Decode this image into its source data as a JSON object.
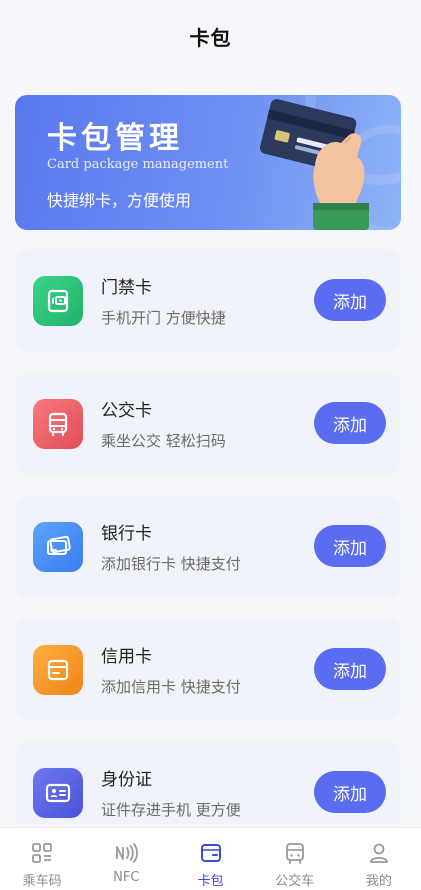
{
  "header": {
    "title": "卡包"
  },
  "banner": {
    "title": "卡包管理",
    "subtitle": "Card package management",
    "description": "快捷绑卡，方便使用"
  },
  "cards": [
    {
      "name": "门禁卡",
      "description": "手机开门  方便快捷",
      "button": "添加",
      "icon": "door-card-icon"
    },
    {
      "name": "公交卡",
      "description": "乘坐公交  轻松扫码",
      "button": "添加",
      "icon": "bus-icon"
    },
    {
      "name": "银行卡",
      "description": "添加银行卡  快捷支付",
      "button": "添加",
      "icon": "bank-card-icon"
    },
    {
      "name": "信用卡",
      "description": "添加信用卡  快捷支付",
      "button": "添加",
      "icon": "credit-card-icon"
    },
    {
      "name": "身份证",
      "description": "证件存进手机  更方便",
      "button": "添加",
      "icon": "id-card-icon"
    }
  ],
  "tabbar": {
    "items": [
      {
        "label": "乘车码",
        "icon": "qr-code-icon",
        "active": false
      },
      {
        "label": "NFC",
        "icon": "nfc-icon",
        "active": false
      },
      {
        "label": "卡包",
        "icon": "wallet-icon",
        "active": true
      },
      {
        "label": "公交车",
        "icon": "bus-icon",
        "active": false
      },
      {
        "label": "我的",
        "icon": "user-icon",
        "active": false
      }
    ]
  },
  "colors": {
    "accent": "#5a6cf0",
    "active_tab": "#3c4bd6",
    "door_card": "#2fc27a",
    "bus_card": "#f0656a",
    "bank_card": "#4a8ef5",
    "credit_card": "#f59a2a",
    "id_card": "#5a63e6"
  }
}
